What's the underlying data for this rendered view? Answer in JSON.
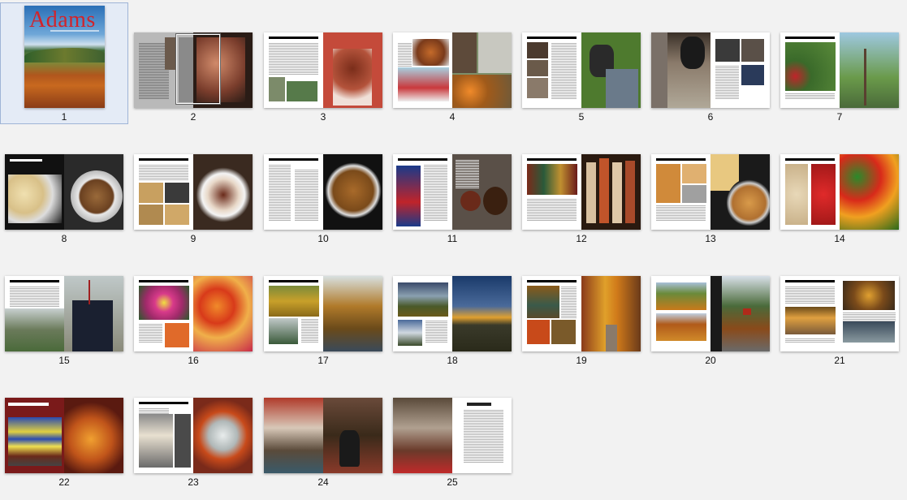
{
  "window": {
    "view": "page-thumbnails",
    "selected_page": "1"
  },
  "cover": {
    "title": "Adams"
  },
  "pages": [
    {
      "label": "1"
    },
    {
      "label": "2"
    },
    {
      "label": "3"
    },
    {
      "label": "4"
    },
    {
      "label": "5"
    },
    {
      "label": "6"
    },
    {
      "label": "7"
    },
    {
      "label": "8"
    },
    {
      "label": "9"
    },
    {
      "label": "10"
    },
    {
      "label": "11"
    },
    {
      "label": "12"
    },
    {
      "label": "13"
    },
    {
      "label": "14"
    },
    {
      "label": "15"
    },
    {
      "label": "16"
    },
    {
      "label": "17"
    },
    {
      "label": "18"
    },
    {
      "label": "19"
    },
    {
      "label": "20"
    },
    {
      "label": "21"
    },
    {
      "label": "22"
    },
    {
      "label": "23"
    },
    {
      "label": "24"
    },
    {
      "label": "25"
    }
  ],
  "colors": {
    "background": "#f2f2f2",
    "selection_fill": "#e4ebf6",
    "selection_border": "#9fb4d6",
    "cover_title": "#d2232a"
  }
}
